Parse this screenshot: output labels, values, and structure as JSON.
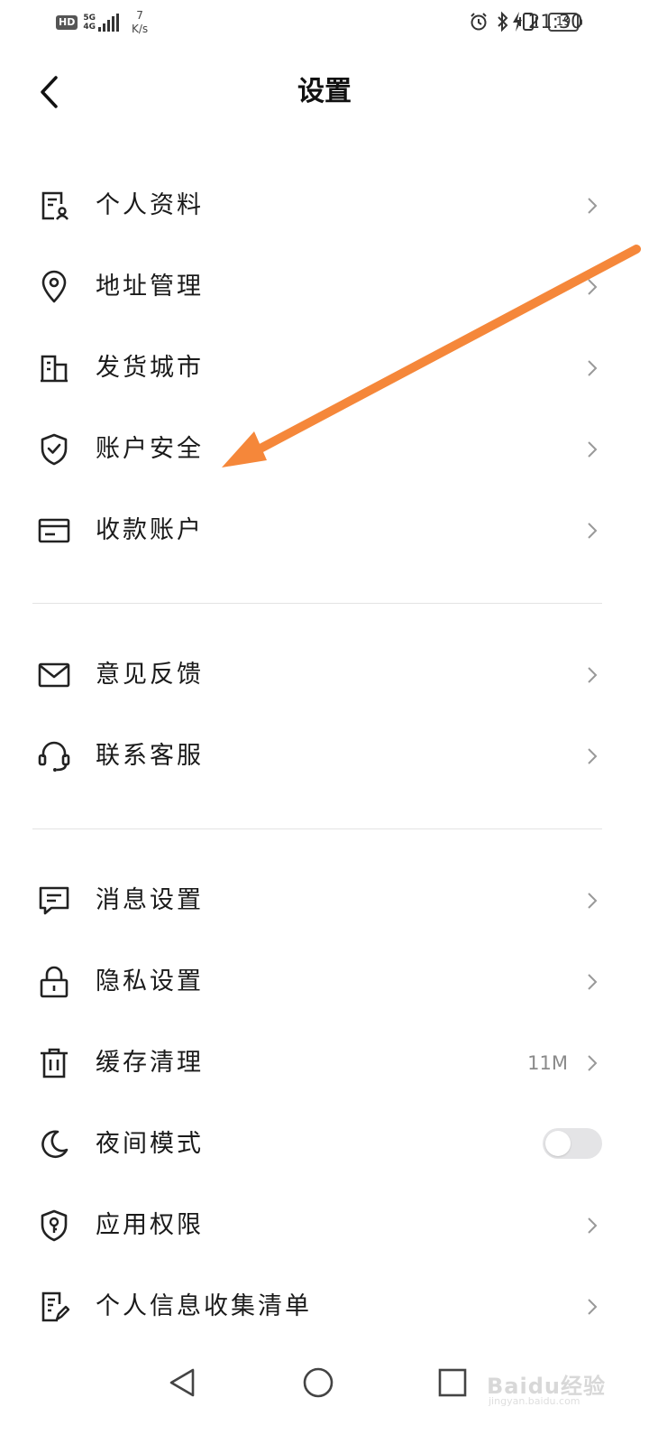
{
  "status_bar": {
    "hd_badge": "HD",
    "network_type": "5G",
    "network_sub": "4G",
    "net_speed_value": "7",
    "net_speed_unit": "K/s",
    "battery_level": "19",
    "time": "21:30",
    "icons": [
      "hd-icon",
      "signal-icon",
      "alarm-icon",
      "bluetooth-icon",
      "vibrate-icon",
      "battery-icon",
      "charging-icon"
    ]
  },
  "header": {
    "title": "设置",
    "back_icon": "back-arrow-icon"
  },
  "sections": [
    {
      "items": [
        {
          "id": "profile",
          "label": "个人资料",
          "icon": "profile-card-icon"
        },
        {
          "id": "address",
          "label": "地址管理",
          "icon": "location-pin-icon"
        },
        {
          "id": "ship-city",
          "label": "发货城市",
          "icon": "building-icon"
        },
        {
          "id": "account-security",
          "label": "账户安全",
          "icon": "shield-check-icon"
        },
        {
          "id": "payment-account",
          "label": "收款账户",
          "icon": "card-icon"
        }
      ]
    },
    {
      "items": [
        {
          "id": "feedback",
          "label": "意见反馈",
          "icon": "mail-icon"
        },
        {
          "id": "customer-service",
          "label": "联系客服",
          "icon": "headset-icon"
        }
      ]
    },
    {
      "items": [
        {
          "id": "message-settings",
          "label": "消息设置",
          "icon": "chat-bubble-icon"
        },
        {
          "id": "privacy-settings",
          "label": "隐私设置",
          "icon": "lock-icon"
        },
        {
          "id": "cache-clear",
          "label": "缓存清理",
          "icon": "trash-icon",
          "value": "11M"
        },
        {
          "id": "night-mode",
          "label": "夜间模式",
          "icon": "moon-icon",
          "toggle": false
        },
        {
          "id": "app-permissions",
          "label": "应用权限",
          "icon": "shield-key-icon"
        },
        {
          "id": "info-list",
          "label": "个人信息收集清单",
          "icon": "document-edit-icon"
        }
      ]
    }
  ],
  "annotation": {
    "arrow_color": "#f5873a",
    "points_to": "账户安全"
  },
  "nav_bar": {
    "buttons": [
      "back-triangle-icon",
      "home-circle-icon",
      "recents-square-icon"
    ]
  },
  "watermark": {
    "text": "Baidu经验",
    "sub": "jingyan.baidu.com"
  }
}
